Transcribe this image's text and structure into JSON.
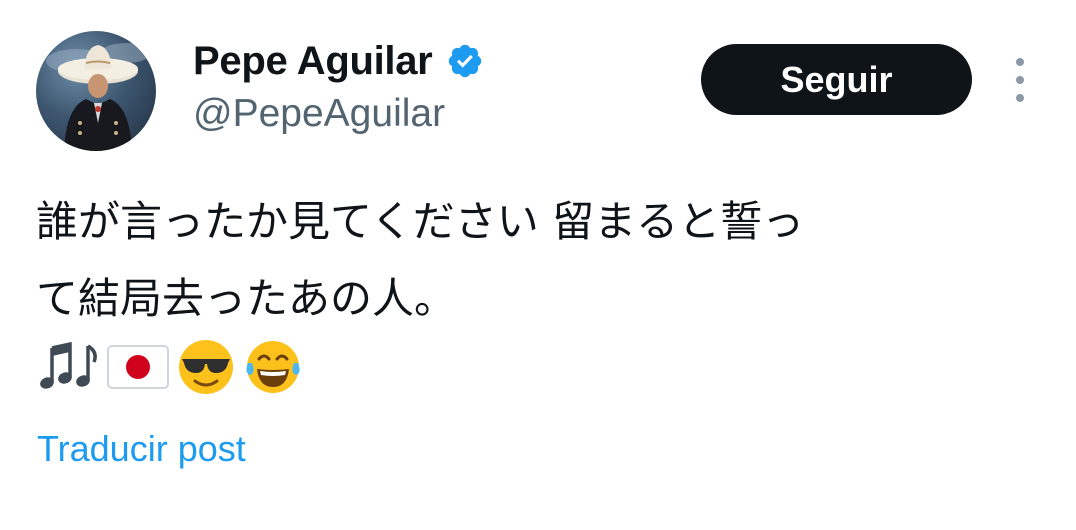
{
  "author": {
    "display_name": "Pepe Aguilar",
    "handle": "@PepeAguilar",
    "verified_icon": "verified-badge-icon",
    "avatar": "avatar-photo"
  },
  "actions": {
    "follow_label": "Seguir",
    "more_icon": "more-vertical-icon"
  },
  "tweet": {
    "text": "誰が言ったか見てください 留まると誓っ\nて結局去ったあの人。",
    "emojis": [
      "musical-notes-emoji",
      "japan-flag-emoji",
      "sunglasses-face-emoji",
      "tears-of-joy-emoji"
    ],
    "translate_label": "Traducir post"
  },
  "colors": {
    "text": "#0f1419",
    "secondary": "#536471",
    "accent": "#1d9bf0",
    "button_bg": "#0f1419"
  }
}
